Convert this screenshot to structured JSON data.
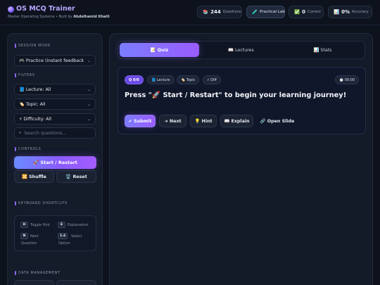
{
  "header": {
    "title": "OS MCQ Trainer",
    "subtitle_prefix": "Master Operating Systems • Built by",
    "author": "Abdelhamid Khalil",
    "stats": {
      "questions_icon": "📚",
      "questions_count": "244",
      "questions_label": "Questions",
      "lab_icon": "🧪",
      "lab_label": "Practical Lab",
      "correct_icon": "✅",
      "correct_count": "0",
      "correct_label": "Correct",
      "accuracy_icon": "📊",
      "accuracy_value": "0%",
      "accuracy_label": "Accuracy"
    }
  },
  "sidebar": {
    "session_mode_title": "SESSION MODE",
    "session_mode_value": "🎮 Practice (instant feedback •",
    "filters_title": "FILTERS",
    "lecture_value": "📘 Lecture: All",
    "topic_value": "🏷️ Topic: All",
    "difficulty_value": "⚡ Difficulty: All",
    "search_placeholder": "Search questions...",
    "controls_title": "CONTROLS",
    "start_label": "🚀 Start / Restart",
    "shuffle_label": "🔀 Shuffle",
    "reset_label": "🗑️ Reset",
    "shortcuts_title": "KEYBOARD SHORTCUTS",
    "shortcuts": {
      "hint_key": "H",
      "hint_label": "Toggle Hint",
      "explain_key": "E",
      "explain_label": "Explanation",
      "next_key": "N",
      "next_label_1": "Next",
      "next_label_2": "Question",
      "select_key": "1-4",
      "select_label_1": "Select",
      "select_label_2": "Option"
    },
    "data_title": "DATA MANAGEMENT"
  },
  "main": {
    "tabs": [
      {
        "label": "📝 Quiz"
      },
      {
        "label": "📖 Lectures"
      },
      {
        "label": "📊 Stats"
      }
    ],
    "badges": {
      "progress": "Q 0/0",
      "lecture": "📘 Lecture",
      "topic": "🏷️ Topic",
      "difficulty": "⚡ Diff",
      "timer": "⏱️ 00:00"
    },
    "question_text": "Press \"🚀 Start / Restart\" to begin your learning journey!",
    "actions": {
      "submit": "✔ Submit",
      "next": "➜ Next",
      "hint": "💡 Hint",
      "explain": "📖 Explain",
      "slide": "🔗 Open Slide"
    }
  },
  "colors": {
    "accent": "#8a5cff",
    "background": "#0d121d",
    "panel": "#141b29"
  }
}
